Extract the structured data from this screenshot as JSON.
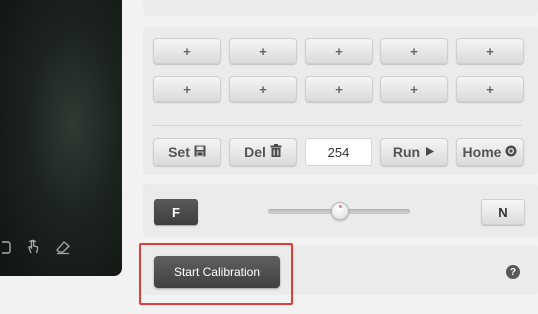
{
  "preset_grid": {
    "rows": [
      [
        "+",
        "+",
        "+",
        "+",
        "+"
      ],
      [
        "+",
        "+",
        "+",
        "+",
        "+"
      ]
    ]
  },
  "actions": {
    "set_label": "Set",
    "del_label": "Del",
    "preset_value": "254",
    "run_label": "Run",
    "home_label": "Home",
    "icons": {
      "set": "floppy-disk-icon",
      "del": "trash-icon",
      "run": "play-triangle-icon",
      "home": "target-circle-icon"
    }
  },
  "focus": {
    "far_label": "F",
    "near_label": "N",
    "slider_level": 0.5
  },
  "calibration": {
    "start_label": "Start Calibration",
    "help_label": "?",
    "highlight_color": "#e23b3b"
  },
  "video_tools": [
    "rectangle-select-icon",
    "tap-gesture-icon",
    "eraser-icon"
  ]
}
